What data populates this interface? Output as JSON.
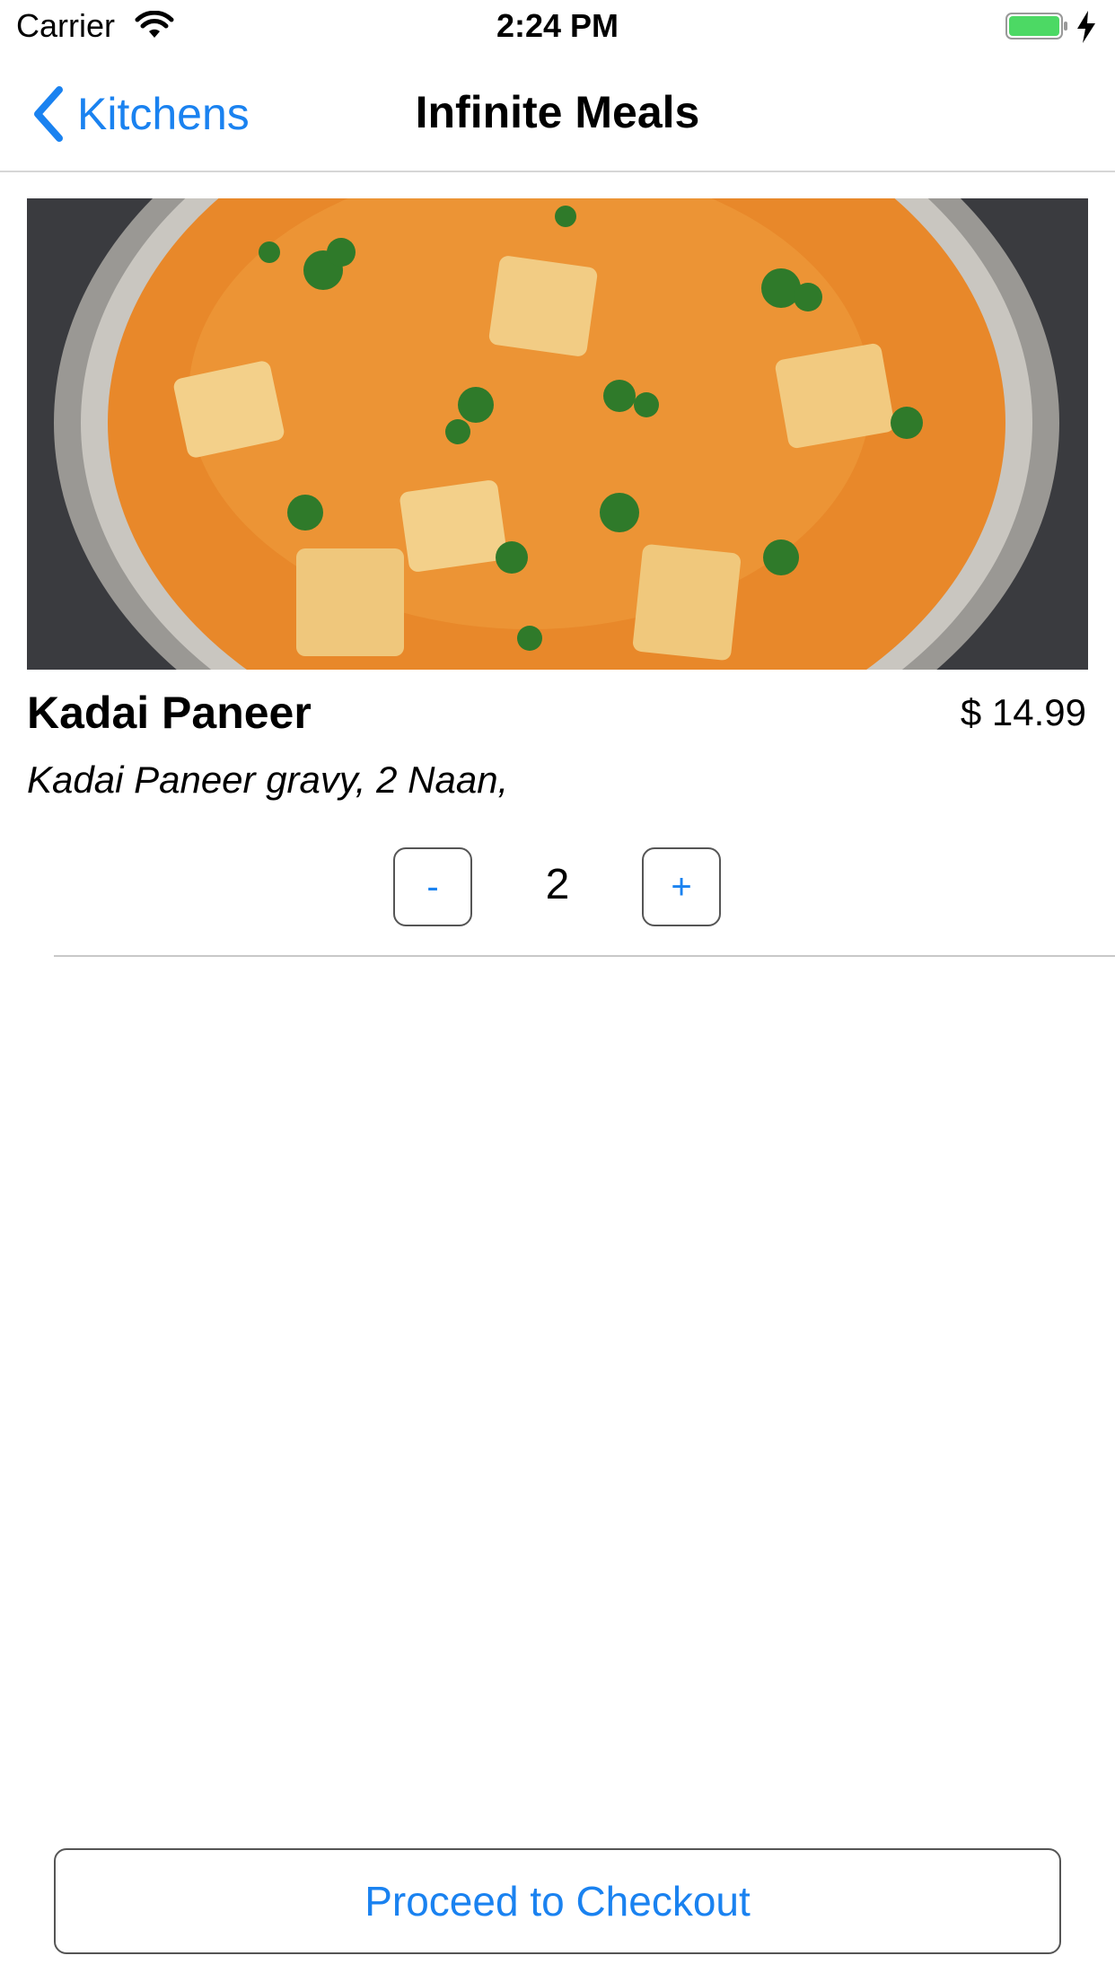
{
  "status_bar": {
    "carrier": "Carrier",
    "time": "2:24 PM"
  },
  "nav": {
    "back_label": "Kitchens",
    "title": "Infinite Meals"
  },
  "meal": {
    "name": "Kadai Paneer",
    "price": "$  14.99",
    "description": "Kadai Paneer gravy, 2 Naan,",
    "quantity": "2",
    "minus_label": "-",
    "plus_label": "+"
  },
  "checkout": {
    "label": "Proceed to Checkout"
  },
  "colors": {
    "accent": "#1a82f0",
    "battery": "#4cd964",
    "curry": "#e8882a"
  },
  "icons": [
    "wifi-icon",
    "battery-icon",
    "charging-bolt-icon",
    "chevron-left-icon"
  ]
}
